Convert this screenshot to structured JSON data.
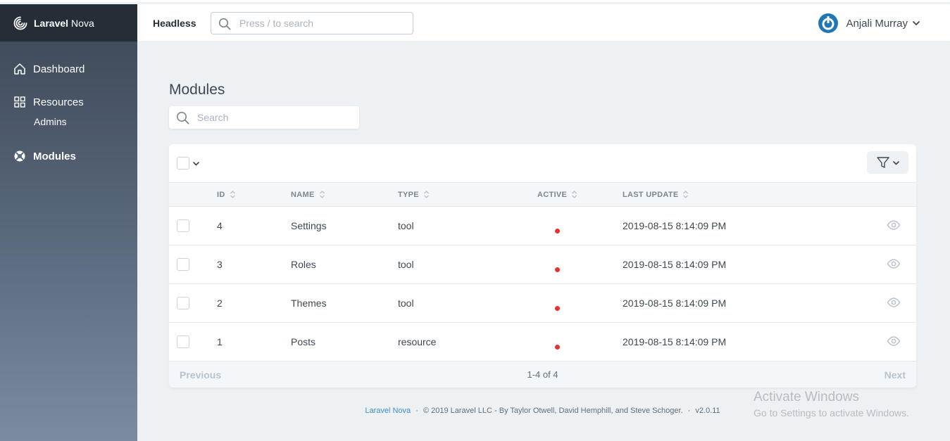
{
  "brand": {
    "bold": "Laravel",
    "light": "Nova"
  },
  "sidebar": {
    "items": [
      {
        "label": "Dashboard",
        "icon": "home-icon"
      },
      {
        "label": "Resources",
        "icon": "grid-icon"
      },
      {
        "label": "Admins"
      },
      {
        "label": "Modules",
        "icon": "lifebuoy-icon"
      }
    ]
  },
  "header": {
    "app_name": "Headless",
    "search_placeholder": "Press / to search",
    "user_name": "Anjali Murray"
  },
  "main": {
    "title": "Modules",
    "search_placeholder": "Search",
    "columns": [
      "ID",
      "NAME",
      "TYPE",
      "ACTIVE",
      "LAST UPDATE"
    ],
    "rows": [
      {
        "id": "4",
        "name": "Settings",
        "type": "tool",
        "active": false,
        "last_update": "2019-08-15 8:14:09 PM"
      },
      {
        "id": "3",
        "name": "Roles",
        "type": "tool",
        "active": false,
        "last_update": "2019-08-15 8:14:09 PM"
      },
      {
        "id": "2",
        "name": "Themes",
        "type": "tool",
        "active": false,
        "last_update": "2019-08-15 8:14:09 PM"
      },
      {
        "id": "1",
        "name": "Posts",
        "type": "resource",
        "active": false,
        "last_update": "2019-08-15 8:14:09 PM"
      }
    ],
    "pagination": {
      "previous": "Previous",
      "info": "1-4 of 4",
      "next": "Next"
    }
  },
  "footer": {
    "link": "Laravel Nova",
    "sep": "·",
    "copyright": "© 2019 Laravel LLC - By Taylor Otwell, David Hemphill, and Steve Schoger.",
    "version": "v2.0.11"
  },
  "watermark": {
    "title": "Activate Windows",
    "subtitle": "Go to Settings to activate Windows."
  },
  "colors": {
    "sidebar_dark": "#252d37",
    "accent": "#1f78b4",
    "inactive_dot": "#e3342f",
    "link": "#3d8fd1"
  }
}
